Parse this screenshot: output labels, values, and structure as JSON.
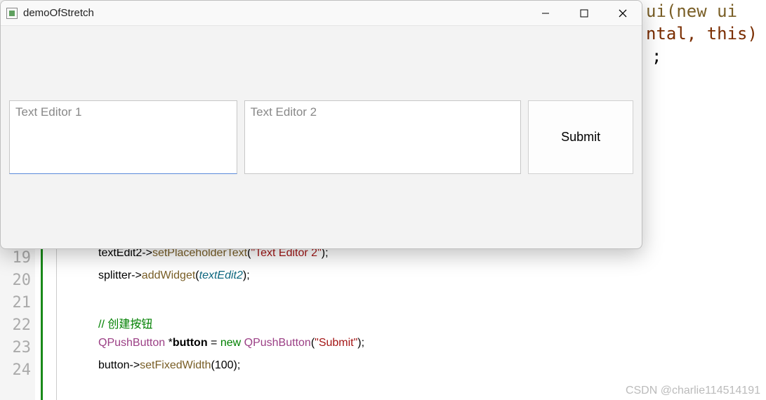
{
  "window": {
    "title": "demoOfStretch",
    "textedit1_placeholder": "Text Editor 1",
    "textedit2_placeholder": "Text Editor 2",
    "submit_label": "Submit"
  },
  "code": {
    "line_numbers": [
      "",
      "",
      "",
      "",
      "",
      "",
      "",
      "",
      "",
      "",
      "",
      "19",
      "20",
      "21",
      "22",
      "23",
      "24"
    ],
    "top_fragment_1": "ui(new ui",
    "top_fragment_2": "ntal, this)",
    "semicolon": ";",
    "line19_a": "textEdit2->",
    "line19_b": "setPlaceholderText",
    "line19_c": "(",
    "line19_d": "\"Text Editor 2\"",
    "line19_e": ");",
    "line20_a": "splitter->",
    "line20_b": "addWidget",
    "line20_c": "(",
    "line20_d": "textEdit2",
    "line20_e": ");",
    "line22": "// 创建按钮",
    "line23_a": "QPushButton",
    "line23_b": " *",
    "line23_c": "button",
    "line23_d": " = ",
    "line23_e": "new",
    "line23_f": " ",
    "line23_g": "QPushButton",
    "line23_h": "(",
    "line23_i": "\"Submit\"",
    "line23_j": ");",
    "line24_a": "button->",
    "line24_b": "setFixedWidth",
    "line24_c": "(100);"
  },
  "watermark": "CSDN @charlie114514191"
}
